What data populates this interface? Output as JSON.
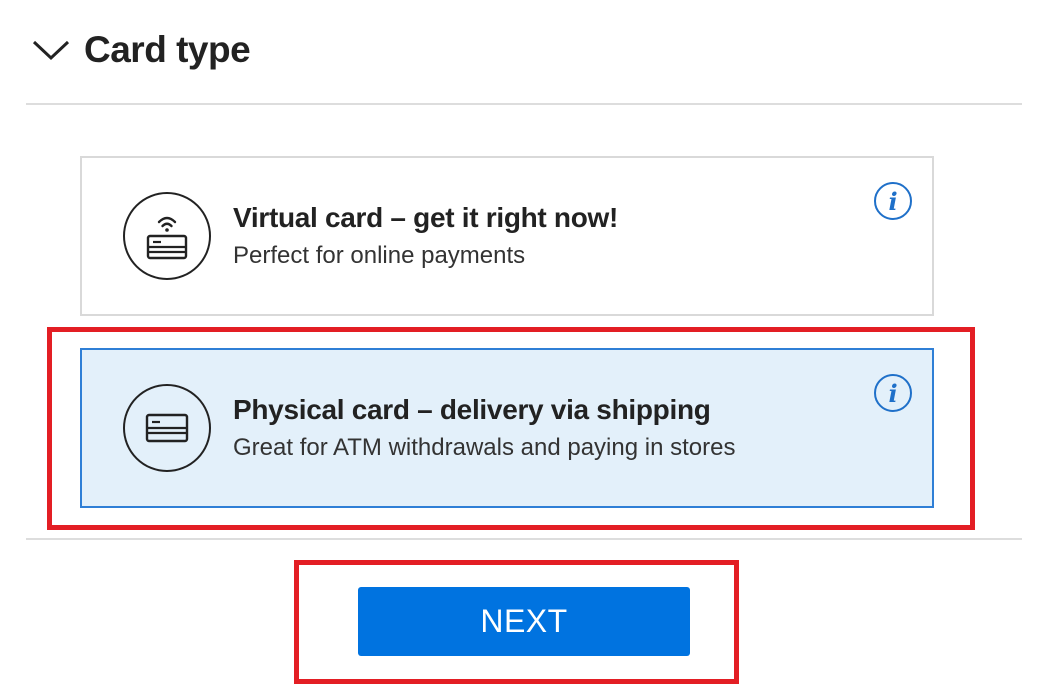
{
  "section": {
    "title": "Card type",
    "chevron_icon": "chevron-down-icon"
  },
  "options": [
    {
      "title": "Virtual card – get it right now!",
      "subtitle": "Perfect for online payments",
      "icon": "contactless-card-icon",
      "info_icon": "info-icon",
      "selected": false
    },
    {
      "title": "Physical card – delivery via shipping",
      "subtitle": "Great for ATM withdrawals and paying in stores",
      "icon": "credit-card-icon",
      "info_icon": "info-icon",
      "selected": true
    }
  ],
  "info_glyph": "i",
  "next_button": {
    "label": "NEXT"
  },
  "colors": {
    "primary": "#0073e0",
    "selected_bg": "#e3f0fa",
    "selected_border": "#2f7fd6",
    "highlight": "#e31e24",
    "info": "#1f70c9"
  }
}
